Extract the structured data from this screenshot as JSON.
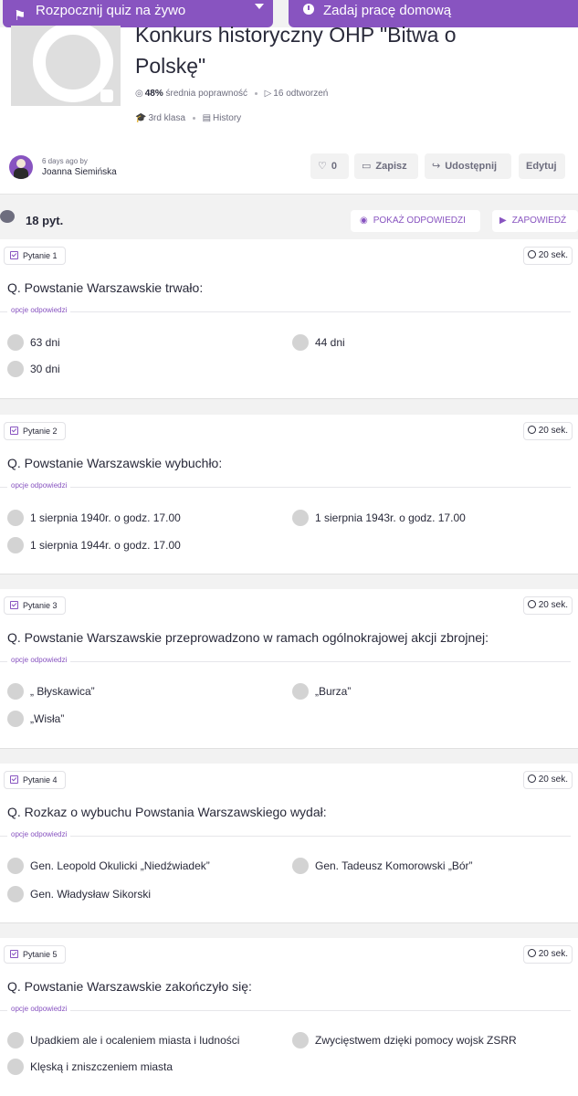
{
  "topbar": {
    "live_quiz_label": "Rozpocznij quiz na żywo",
    "homework_label": "Zadaj pracę domową"
  },
  "quiz": {
    "title_line1": "Konkurs historyczny OHP \"Bitwa o",
    "title_line2": "Polskę\"",
    "accuracy": "48%",
    "accuracy_label": "średnia poprawność",
    "plays": "16 odtworzeń",
    "grade": "3rd klasa",
    "subject": "History",
    "author_when": "6 days ago by",
    "author_name": "Joanna Siemińska",
    "likes": "0",
    "save_label": "Zapisz",
    "share_label": "Udostępnij",
    "edit_label": "Edytuj"
  },
  "questions_header": {
    "count": "18 pyt.",
    "show_answers_label": "POKAŻ ODPOWIEDZI",
    "preview_label": "ZAPOWIEDŹ"
  },
  "options_label": "opcje odpowiedzi",
  "questions": [
    {
      "tag": "Pytanie 1",
      "time": "20 sek.",
      "text": "Q. Powstanie Warszawskie trwało:",
      "options": [
        "63 dni",
        "44 dni",
        "30 dni"
      ]
    },
    {
      "tag": "Pytanie 2",
      "time": "20 sek.",
      "text": "Q. Powstanie Warszawskie wybuchło:",
      "options": [
        "1 sierpnia 1940r. o godz. 17.00",
        "1 sierpnia 1943r. o godz. 17.00",
        "1 sierpnia 1944r. o godz. 17.00"
      ]
    },
    {
      "tag": "Pytanie 3",
      "time": "20 sek.",
      "text": "Q. Powstanie Warszawskie przeprowadzono w ramach ogólnokrajowej akcji zbrojnej:",
      "options": [
        "„ Błyskawica”",
        "„Burza”",
        "„Wisła”"
      ]
    },
    {
      "tag": "Pytanie 4",
      "time": "20 sek.",
      "text": "Q. Rozkaz o wybuchu Powstania Warszawskiego wydał:",
      "options": [
        "Gen. Leopold Okulicki „Niedźwiadek”",
        "Gen. Tadeusz Komorowski „Bór”",
        "Gen. Władysław Sikorski"
      ]
    },
    {
      "tag": "Pytanie 5",
      "time": "20 sek.",
      "text": "Q. Powstanie Warszawskie zakończyło się:",
      "options": [
        "Upadkiem ale i ocaleniem miasta i ludności",
        "Zwycięstwem dzięki pomocy wojsk ZSRR",
        "Klęską i zniszczeniem miasta"
      ]
    }
  ]
}
